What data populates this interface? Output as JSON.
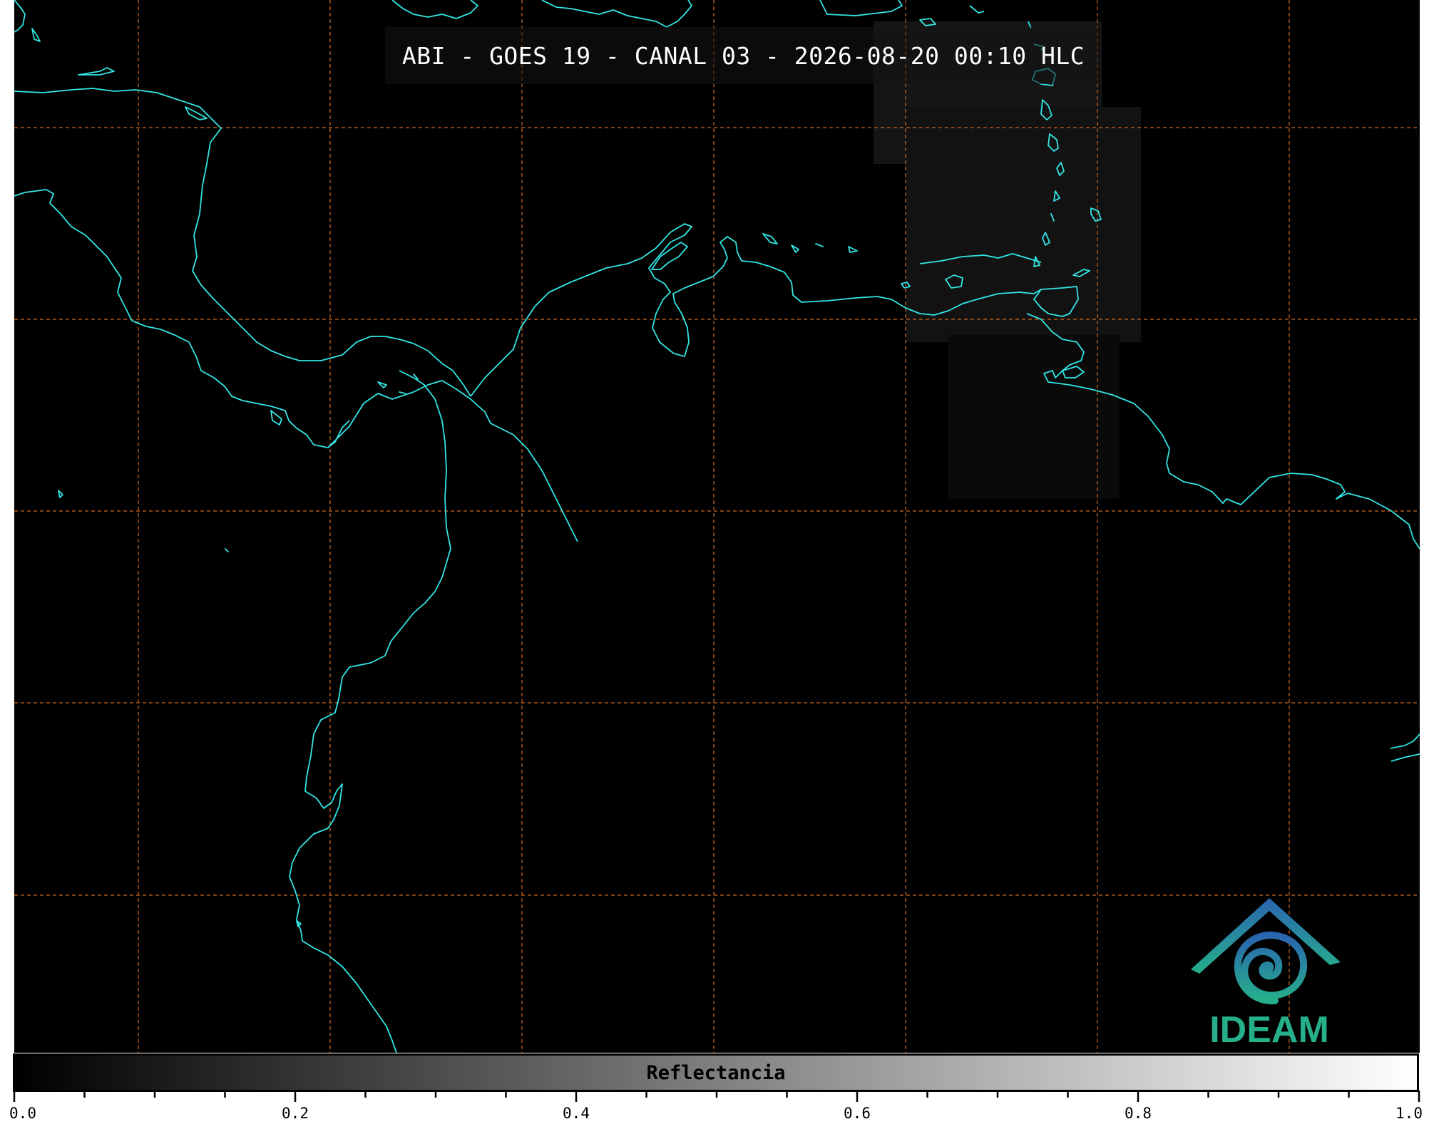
{
  "title": "ABI - GOES 19 - CANAL 03 - 2026-08-20 00:10 HLC",
  "colors": {
    "background": "#000000",
    "coastline": "#33e6e6",
    "graticule": "#d2691e",
    "title_text": "#ffffff",
    "logo_blue": "#2a7fb8",
    "logo_green": "#26b08a"
  },
  "logo": {
    "name": "IDEAM",
    "text": "IDEAM"
  },
  "colorbar": {
    "label": "Reflectancia",
    "colormap": "grayscale",
    "min": 0.0,
    "max": 1.0,
    "tick_labels": [
      "0.0",
      "0.2",
      "0.4",
      "0.6",
      "0.8",
      "1.0"
    ],
    "tick_values": [
      0.0,
      0.2,
      0.4,
      0.6,
      0.8,
      1.0
    ],
    "minor_tick_step": 0.05
  },
  "map": {
    "graticule": "dashed",
    "coastlines": true
  }
}
